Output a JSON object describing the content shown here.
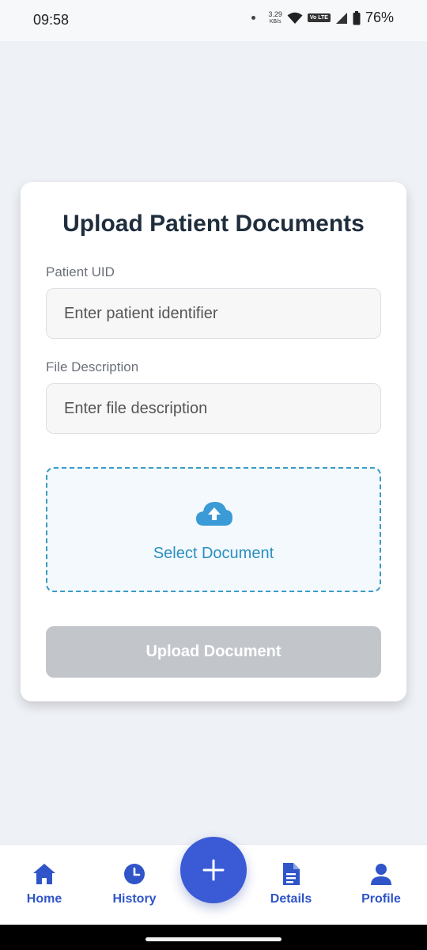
{
  "status_bar": {
    "time": "09:58",
    "speed_value": "3.29",
    "speed_unit": "KB/s",
    "volte_label": "Vo LTE",
    "battery": "76%"
  },
  "form": {
    "title": "Upload Patient Documents",
    "patient_uid_label": "Patient UID",
    "patient_uid_placeholder": "Enter patient identifier",
    "file_description_label": "File Description",
    "file_description_placeholder": "Enter file description",
    "select_document_label": "Select Document",
    "upload_button_label": "Upload Document"
  },
  "nav": {
    "items": [
      {
        "label": "Home",
        "icon": "home-icon"
      },
      {
        "label": "History",
        "icon": "clock-icon"
      },
      {
        "label": "Details",
        "icon": "document-icon"
      },
      {
        "label": "Profile",
        "icon": "user-icon"
      }
    ],
    "fab_icon": "plus-icon"
  },
  "colors": {
    "accent": "#3b5bd6",
    "nav_label": "#2f55c8",
    "drop_zone_border": "#3a9bc7",
    "button_disabled": "#c2c6cb",
    "title": "#1f2d3d"
  }
}
